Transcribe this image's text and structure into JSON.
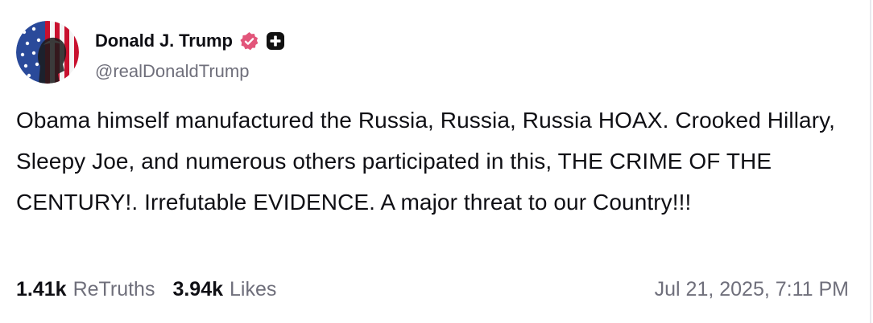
{
  "author": {
    "display_name": "Donald J. Trump",
    "handle": "@realDonaldTrump",
    "avatar_icon": "profile-photo",
    "verified_icon": "verified-badge-icon",
    "plus_icon": "plus-badge-icon"
  },
  "post": {
    "text": "Obama himself manufactured the Russia, Russia, Russia HOAX. Crooked Hillary, Sleepy Joe, and numerous others participated in this, THE CRIME OF THE CENTURY!. Irrefutable EVIDENCE. A major threat to our Country!!!"
  },
  "stats": {
    "retruths_count": "1.41k",
    "retruths_label": "ReTruths",
    "likes_count": "3.94k",
    "likes_label": "Likes"
  },
  "timestamp": "Jul 21, 2025, 7:11 PM",
  "colors": {
    "text_primary": "#0f0f14",
    "text_secondary": "#6f6f7b",
    "verified_badge": "#e2557a",
    "plus_badge": "#111111"
  }
}
